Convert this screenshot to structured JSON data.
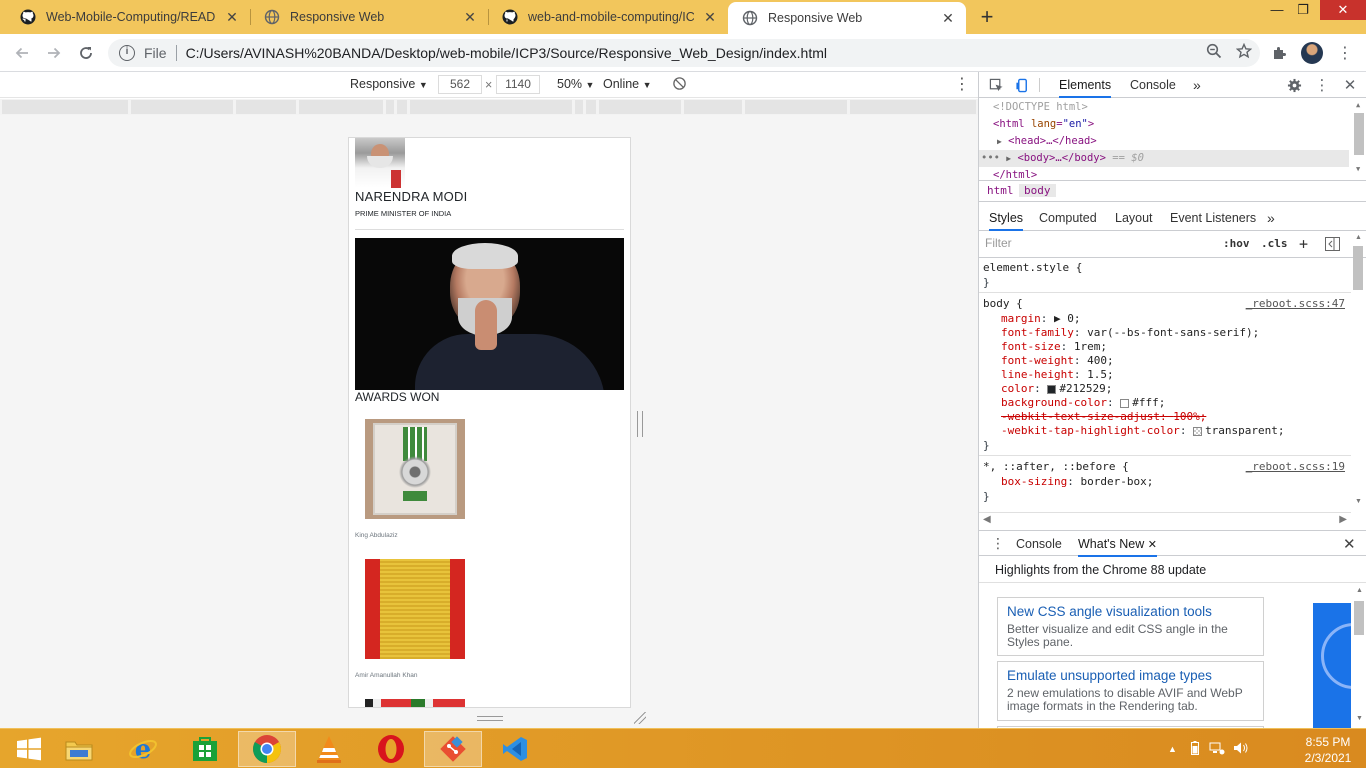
{
  "browser": {
    "tabs": [
      {
        "title": "Web-Mobile-Computing/README",
        "icon": "github-icon",
        "active": false
      },
      {
        "title": "Responsive Web",
        "icon": "globe-icon",
        "active": false
      },
      {
        "title": "web-and-mobile-computing/ICP",
        "icon": "github-icon",
        "active": false
      },
      {
        "title": "Responsive Web",
        "icon": "globe-icon",
        "active": true
      }
    ],
    "new_tab": "+",
    "window": {
      "minimize": "—",
      "maximize": "❐",
      "close": "✕"
    },
    "omnibox": {
      "scheme_label": "File",
      "url": "C:/Users/AVINASH%20BANDA/Desktop/web-mobile/ICP3/Source/Responsive_Web_Design/index.html"
    }
  },
  "device_toolbar": {
    "mode": "Responsive",
    "width": "562",
    "times": "×",
    "height": "1140",
    "zoom": "50%",
    "network": "Online"
  },
  "page": {
    "name": "NARENDRA MODI",
    "role": "PRIME MINISTER OF INDIA",
    "awards_heading": "AWARDS WON",
    "awards": [
      {
        "caption": "King Abdulaziz"
      },
      {
        "caption": "Amir Amanullah Khan"
      }
    ]
  },
  "devtools": {
    "panels": [
      "Elements",
      "Console"
    ],
    "more": "»",
    "dom": {
      "doctype": "<!DOCTYPE html>",
      "html_open_tag": "html",
      "html_attr_name": "lang",
      "html_attr_value": "\"en\"",
      "head": "<head>…</head>",
      "body": "<body>…</body>",
      "body_ref": "== $0",
      "html_close": "</html>"
    },
    "breadcrumbs": [
      "html",
      "body"
    ],
    "style_tabs": [
      "Styles",
      "Computed",
      "Layout",
      "Event Listeners"
    ],
    "filter_placeholder": "Filter",
    "hov": ":hov",
    "cls": ".cls",
    "rules": {
      "element_style": "element.style {",
      "close": "}",
      "body_selector": "body {",
      "body_source": "_reboot.scss:47",
      "decls": [
        {
          "prop": "margin",
          "val": "▶ 0;"
        },
        {
          "prop": "font-family",
          "val": "var(--bs-font-sans-serif);"
        },
        {
          "prop": "font-size",
          "val": "1rem;"
        },
        {
          "prop": "font-weight",
          "val": "400;"
        },
        {
          "prop": "line-height",
          "val": "1.5;"
        },
        {
          "prop": "color",
          "val": "#212529;"
        },
        {
          "prop": "background-color",
          "val": "#fff;"
        },
        {
          "prop": "-webkit-text-size-adjust",
          "val": "100%;"
        },
        {
          "prop": "-webkit-tap-highlight-color",
          "val": "transparent;"
        }
      ],
      "universal_selector": "*, ::after, ::before {",
      "universal_source": "_reboot.scss:19",
      "universal_decl": {
        "prop": "box-sizing",
        "val": "border-box;"
      }
    },
    "drawer": {
      "tabs": [
        "Console",
        "What's New"
      ],
      "heading": "Highlights from the Chrome 88 update",
      "items": [
        {
          "title": "New CSS angle visualization tools",
          "desc": "Better visualize and edit CSS angle in the Styles pane."
        },
        {
          "title": "Emulate unsupported image types",
          "desc": "2 new emulations to disable AVIF and WebP image formats in the Rendering tab."
        }
      ]
    }
  },
  "taskbar": {
    "apps": [
      "start-button",
      "file-explorer",
      "internet-explorer",
      "store",
      "chrome",
      "vlc",
      "opera",
      "git",
      "vscode"
    ],
    "time": "8:55 PM",
    "date": "2/3/2021"
  },
  "colors": {
    "tabstrip": "#f2c65c",
    "taskbar": "#e6a52c",
    "accent": "#1a73e8",
    "body_color_swatch": "#212529"
  }
}
